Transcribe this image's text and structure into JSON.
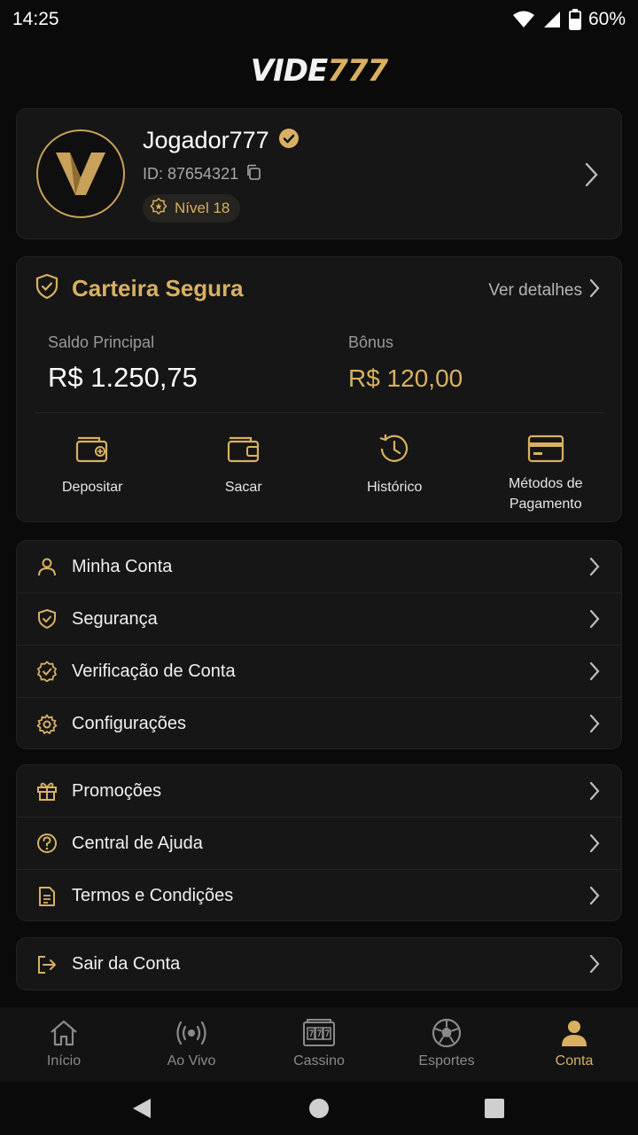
{
  "status": {
    "time": "14:25",
    "battery": "60%"
  },
  "brand": {
    "part1": "VIDE",
    "part2": "777"
  },
  "profile": {
    "username": "Jogador777",
    "id_text": "ID: 87654321",
    "level": "Nível 18"
  },
  "wallet": {
    "title": "Carteira Segura",
    "details_link": "Ver detalhes",
    "main_label": "Saldo Principal",
    "main_value": "R$ 1.250,75",
    "bonus_label": "Bônus",
    "bonus_value": "R$ 120,00",
    "actions": [
      {
        "label": "Depositar",
        "icon": "wallet-deposit-icon"
      },
      {
        "label": "Sacar",
        "icon": "wallet-icon"
      },
      {
        "label": "Histórico",
        "icon": "history-icon"
      },
      {
        "label_line1": "Métodos de",
        "label_line2": "Pagamento",
        "icon": "credit-card-icon"
      }
    ]
  },
  "menu_account": [
    {
      "label": "Minha Conta",
      "icon": "user-icon"
    },
    {
      "label": "Segurança",
      "icon": "shield-icon"
    },
    {
      "label": "Verificação de Conta",
      "icon": "verified-badge-icon"
    },
    {
      "label": "Configurações",
      "icon": "gear-icon"
    }
  ],
  "menu_info": [
    {
      "label": "Promoções",
      "icon": "gift-icon"
    },
    {
      "label": "Central de Ajuda",
      "icon": "help-icon"
    },
    {
      "label": "Termos e Condições",
      "icon": "document-icon"
    }
  ],
  "menu_logout": {
    "label": "Sair da Conta",
    "icon": "logout-icon"
  },
  "bottom_nav": [
    {
      "label": "Início",
      "icon": "home-icon"
    },
    {
      "label": "Ao Vivo",
      "icon": "live-icon"
    },
    {
      "label": "Cassino",
      "icon": "slot-machine-icon"
    },
    {
      "label": "Esportes",
      "icon": "soccer-ball-icon"
    },
    {
      "label": "Conta",
      "icon": "account-icon",
      "active": true
    }
  ],
  "colors": {
    "accent": "#d9b061",
    "background": "#0a0a0a",
    "card": "#161616",
    "text_muted": "#9a9a9a"
  }
}
